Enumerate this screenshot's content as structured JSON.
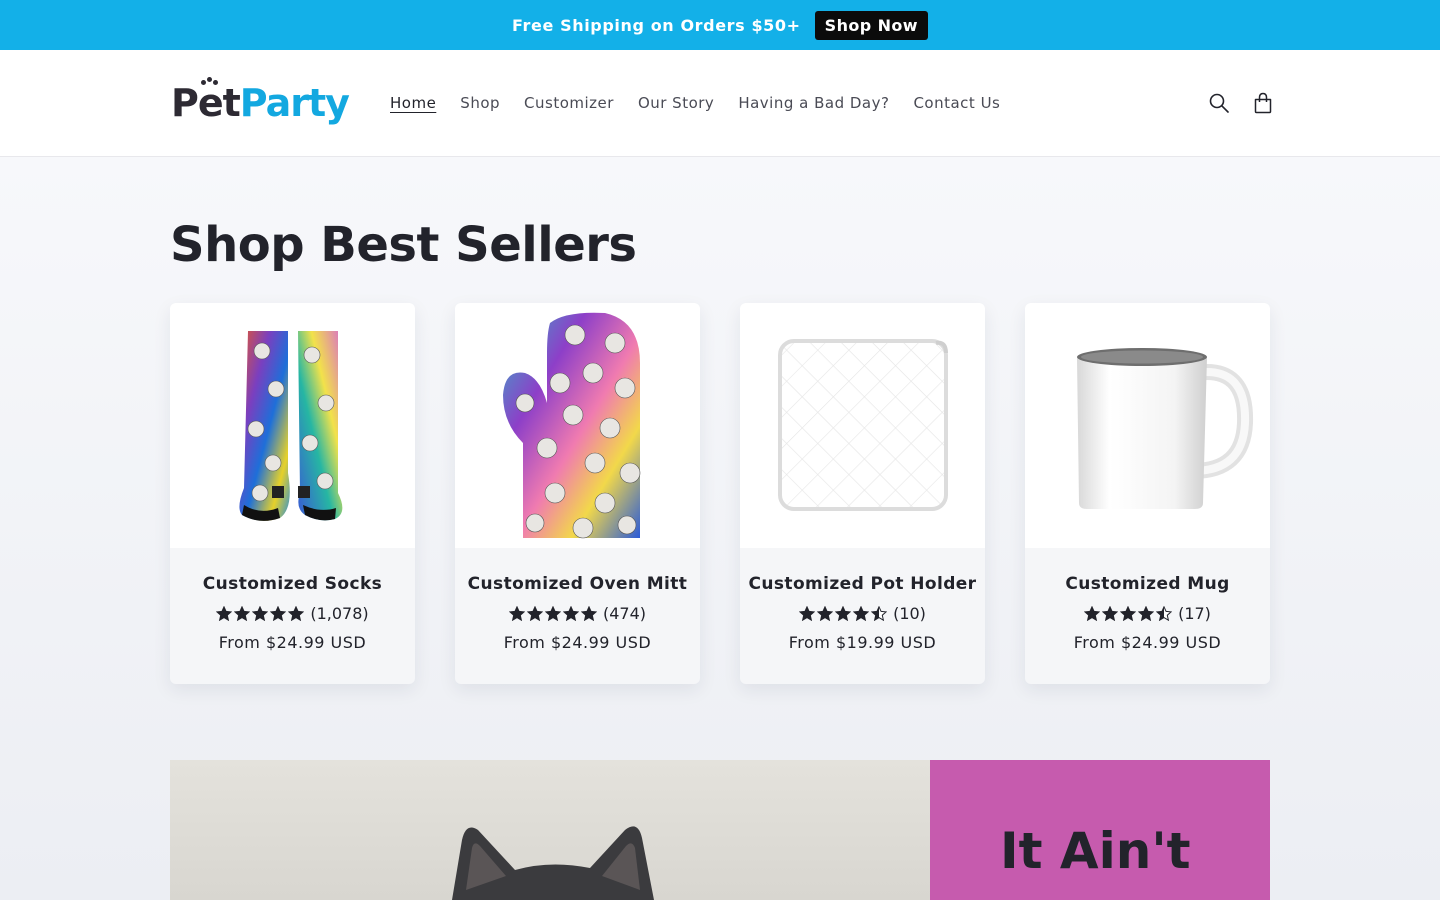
{
  "announcement": {
    "text": "Free Shipping on Orders $50+",
    "button_label": "Shop Now"
  },
  "header": {
    "logo": {
      "part1": "Pet",
      "part2": "Party"
    },
    "nav": [
      {
        "label": "Home",
        "active": true
      },
      {
        "label": "Shop",
        "active": false
      },
      {
        "label": "Customizer",
        "active": false
      },
      {
        "label": "Our Story",
        "active": false
      },
      {
        "label": "Having a Bad Day?",
        "active": false
      },
      {
        "label": "Contact Us",
        "active": false
      }
    ],
    "icons": [
      "search-icon",
      "cart-icon"
    ]
  },
  "best_sellers": {
    "title": "Shop Best Sellers",
    "products": [
      {
        "name": "Customized Socks",
        "rating": 5,
        "reviews": "(1,078)",
        "price": "From $24.99 USD",
        "image": "galaxy-cat-socks"
      },
      {
        "name": "Customized Oven Mitt",
        "rating": 5,
        "reviews": "(474)",
        "price": "From $24.99 USD",
        "image": "galaxy-cat-oven-mitt"
      },
      {
        "name": "Customized Pot Holder",
        "rating": 4.5,
        "reviews": "(10)",
        "price": "From $19.99 USD",
        "image": "white-pot-holder"
      },
      {
        "name": "Customized Mug",
        "rating": 4.5,
        "reviews": "(17)",
        "price": "From $24.99 USD",
        "image": "white-mug"
      }
    ]
  },
  "banner": {
    "heading": "It Ain't",
    "panel_color": "#c65bae"
  },
  "colors": {
    "accent": "#13b0e8",
    "text": "#22232b",
    "announce_button": "#0b0b0b"
  }
}
